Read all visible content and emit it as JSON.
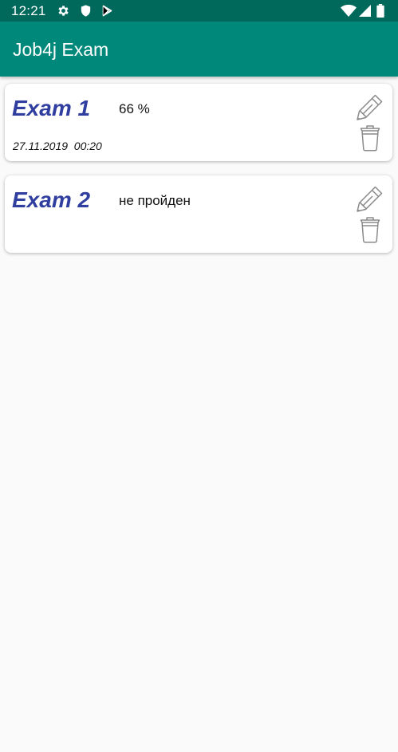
{
  "status_bar": {
    "time": "12:21",
    "icons": [
      "gear-icon",
      "shield-icon",
      "play-store-icon",
      "wifi-icon",
      "signal-icon",
      "battery-icon"
    ],
    "background": "#00695c"
  },
  "app_bar": {
    "title": "Job4j Exam",
    "background": "#00897b"
  },
  "exams": [
    {
      "name": "Exam 1",
      "result": "66 %",
      "date": "27.11.2019  00:20",
      "actions": [
        "pencil-icon",
        "trash-icon"
      ]
    },
    {
      "name": "Exam 2",
      "result": "не пройден",
      "date": "",
      "actions": [
        "pencil-icon",
        "trash-icon"
      ]
    }
  ],
  "colors": {
    "exam_name": "#303f9f",
    "page_background": "#fafafa"
  }
}
